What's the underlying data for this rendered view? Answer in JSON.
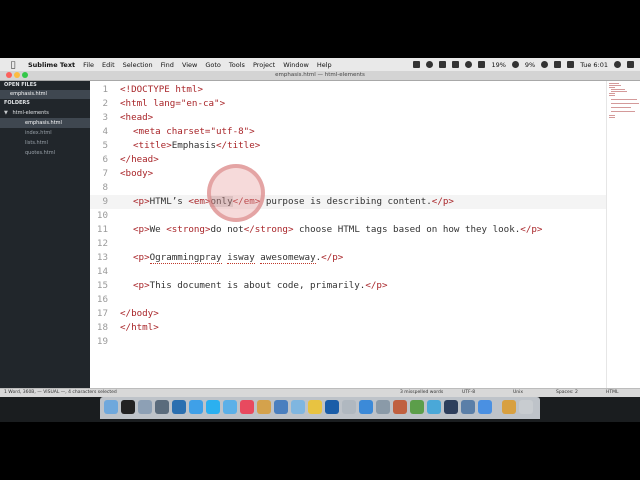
{
  "menubar": {
    "app_name": "Sublime Text",
    "menus": [
      "File",
      "Edit",
      "Selection",
      "Find",
      "View",
      "Goto",
      "Tools",
      "Project",
      "Window",
      "Help"
    ],
    "battery": "19%",
    "volume": "9%",
    "clock": "Tue 6:01"
  },
  "window": {
    "title": "emphasis.html — html-elements"
  },
  "sidebar": {
    "open_files_label": "OPEN FILES",
    "open_file": "emphasis.html",
    "folders_label": "FOLDERS",
    "folder_name": "html-elements",
    "files": [
      "emphasis.html",
      "index.html",
      "lists.html",
      "quotes.html"
    ]
  },
  "editor": {
    "line_numbers": [
      "1",
      "2",
      "3",
      "4",
      "5",
      "6",
      "7",
      "8",
      "9",
      "10",
      "11",
      "12",
      "13",
      "14",
      "15",
      "16",
      "17",
      "18",
      "19"
    ],
    "lines": {
      "l1_tag": "<!DOCTYPE html>",
      "l2_tag": "<html lang=\"en-ca\">",
      "l3_tag": "<head>",
      "l4_tag": "<meta charset=\"utf-8\">",
      "l5_open": "<title>",
      "l5_text": "Emphasis",
      "l5_close": "</title>",
      "l6_tag": "</head>",
      "l7_tag": "<body>",
      "l9_p_open": "<p>",
      "l9_text1": "HTML’s ",
      "l9_em_open": "<em>",
      "l9_sel": "only",
      "l9_em_close": "</em>",
      "l9_text2": " purpose is describing content.",
      "l9_p_close": "</p>",
      "l11_p_open": "<p>",
      "l11_text1": "We ",
      "l11_strong_open": "<strong>",
      "l11_strong_text": "do not",
      "l11_strong_close": "</strong>",
      "l11_text2": " choose HTML tags based on how they look.",
      "l11_p_close": "</p>",
      "l13_p_open": "<p>",
      "l13_w1": "Ogrammingpray",
      "l13_sp1": " ",
      "l13_w2": "isway",
      "l13_sp2": " ",
      "l13_w3": "awesomeway",
      "l13_period": ".",
      "l13_p_close": "</p>",
      "l15_p_open": "<p>",
      "l15_text": "This document is about code, primarily.",
      "l15_p_close": "</p>",
      "l17_tag": "</body>",
      "l18_tag": "</html>"
    }
  },
  "statusbar": {
    "left": "1 Word, 360B, — VISUAL —, 4 characters selected",
    "misspelled": "3 misspelled words",
    "encoding": "UTF-8",
    "line_endings": "Unix",
    "indent": "Spaces: 2",
    "syntax": "HTML"
  },
  "colors": {
    "tag": "#a9262a",
    "sidebar_bg": "#21262b",
    "editor_bg": "#ffffff"
  }
}
